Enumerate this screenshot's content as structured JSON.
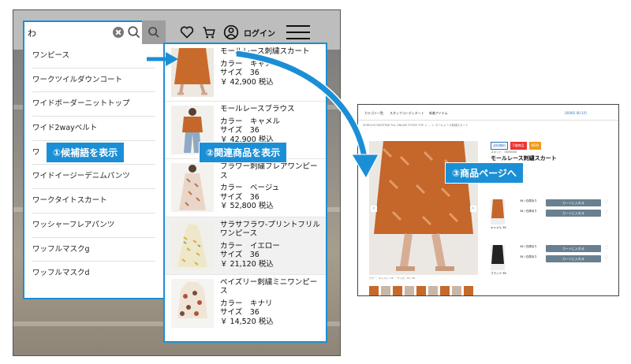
{
  "header": {
    "login_label": "ログイン"
  },
  "search": {
    "value": "わ",
    "placeholder": ""
  },
  "suggestions": [
    "ワンピース",
    "ワークツイルダウンコート",
    "ワイドボーダーニットトップ",
    "ワイド2wayベルト",
    "ワ",
    "ワイドイージーデニムパンツ",
    "ワークタイトスカート",
    "ワッシャーフレアパンツ",
    "ワッフルマスクg",
    "ワッフルマスクd"
  ],
  "products": [
    {
      "name": "モールレース刺繍スカート",
      "color_label": "カラー",
      "color": "キャメル",
      "size_label": "サイズ",
      "size": "36",
      "price": "￥ 42,900 税込"
    },
    {
      "name": "モールレースブラウス",
      "color_label": "カラー",
      "color": "キャメル",
      "size_label": "サイズ",
      "size": "36",
      "price": "￥ 42,900 税込"
    },
    {
      "name": "フラワー刺繍フレアワンピース",
      "color_label": "カラー",
      "color": "ベージュ",
      "size_label": "サイズ",
      "size": "36",
      "price": "￥ 52,800 税込"
    },
    {
      "name": "サラサフラワ-プリントフリルワンピース",
      "color_label": "カラー",
      "color": "イエロー",
      "size_label": "サイズ",
      "size": "36",
      "price": "￥ 21,120 税込"
    },
    {
      "name": "ペイズリー刺繍ミニワンピース",
      "color_label": "カラー",
      "color": "キナリ",
      "size_label": "サイズ",
      "size": "36",
      "price": "￥ 14,520 税込"
    }
  ],
  "badges": {
    "step1": "①候補語を表示",
    "step2": "②関連商品を表示",
    "step3": "③商品ページへ"
  },
  "pdp": {
    "nav": [
      "カテゴリー覧",
      "スタッフコーディネート",
      "新着アイテム"
    ],
    "nav_right": "[0000] 00-1円",
    "breadcrumb": "SHIROUCOVERTPAR TAL ONLINE STORE TOP ＞ ... ＞ モールレース刺繍スカート",
    "tags": [
      "送料無料",
      "5億商品",
      "NEW"
    ],
    "small": "スキット　0000000",
    "title": "モールレース刺繍スカート",
    "variants": [
      {
        "rows": [
          {
            "size": "36 / 在庫あり",
            "status": ""
          },
          {
            "size": "38 / 在庫あり",
            "status": ""
          }
        ],
        "cart": "カートに入れる",
        "label": "キャメル 36"
      },
      {
        "rows": [
          {
            "size": "36 / 在庫あり",
            "status": ""
          },
          {
            "size": "38 / 在庫あり",
            "status": ""
          }
        ],
        "cart": "カートに入れる",
        "label": "ブラック 36"
      }
    ],
    "caption": "カラー：キャメル / 36 ・ サイズ：36 / 38"
  },
  "colors": {
    "accent": "#1b8fd6",
    "cart": "#68808f"
  }
}
